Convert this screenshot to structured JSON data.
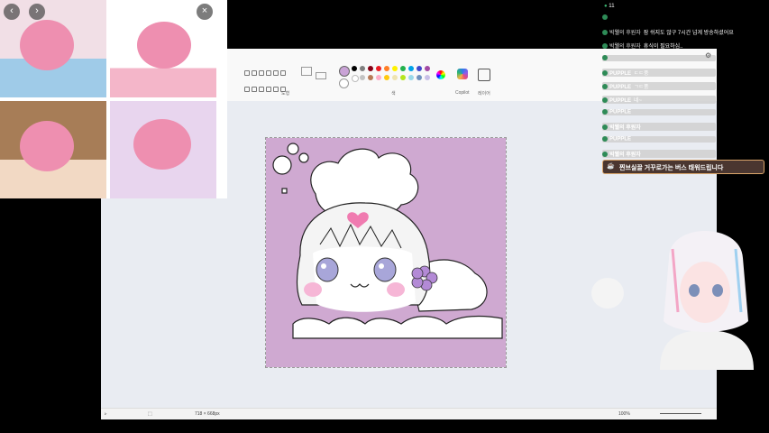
{
  "live_count": "11",
  "chat": [
    {
      "user": "",
      "message": "",
      "style": "plain"
    },
    {
      "user": "빅웰의 후원자",
      "message": "잠 쉬지도 않구 7시간 넘게 방송하셨어요",
      "style": "plain"
    },
    {
      "user": "빅웰의 후원자",
      "message": "휴식이 필요하심..",
      "style": "plain"
    },
    {
      "user": "",
      "message": "",
      "style": "box"
    },
    {
      "user": "PUPPLE",
      "message": "ㄷㄷ풍",
      "style": "box"
    },
    {
      "user": "PUPPLE",
      "message": "ㄱㄷ풍",
      "style": "box"
    },
    {
      "user": "PUPPLE",
      "message": "네~",
      "style": "box"
    },
    {
      "user": "PUPPLE",
      "message": "",
      "style": "box"
    },
    {
      "user": "빅웰의 후원자",
      "message": "",
      "style": "box"
    },
    {
      "user": "PUPPLE",
      "message": "",
      "style": "box"
    },
    {
      "user": "빅웰의 후원자",
      "message": "",
      "style": "box"
    }
  ],
  "pinned_notice": "찐브실끌 거꾸로가는 버스 태워드립니다",
  "paint": {
    "group_shapes_label": "도형",
    "group_colors_label": "색",
    "copilot_label": "Copilot",
    "layers_label": "레이어",
    "canvas_size": "718 × 668px",
    "zoom": "100%",
    "palette": [
      "#000000",
      "#7f7f7f",
      "#880015",
      "#ed1c24",
      "#ff7f27",
      "#fff200",
      "#22b14c",
      "#00a2e8",
      "#3f48cc",
      "#a349a4",
      "#ffffff",
      "#c3c3c3",
      "#b97a57",
      "#ffaec9",
      "#ffc90e",
      "#efe4b0",
      "#b5e61d",
      "#99d9ea",
      "#7092be",
      "#c8bfe7"
    ],
    "selected_color": "#c9a3d6",
    "canvas_bg": "#cfa9d1"
  },
  "ref_nav": {
    "prev": "‹",
    "next": "›",
    "close": "×"
  }
}
